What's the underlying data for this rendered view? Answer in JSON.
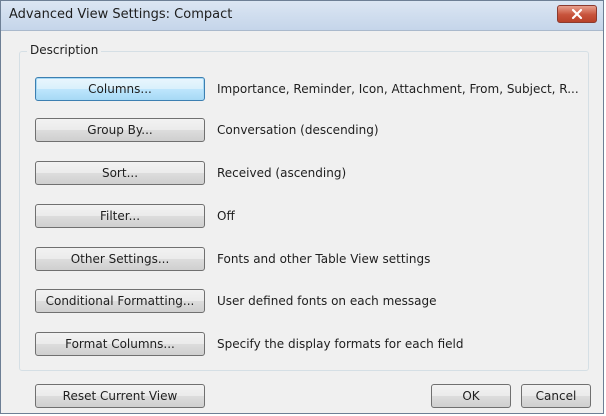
{
  "window": {
    "title": "Advanced View Settings: Compact"
  },
  "description_label": "Description",
  "settings": [
    {
      "button": "Columns...",
      "value": "Importance, Reminder, Icon, Attachment, From, Subject, R..."
    },
    {
      "button": "Group By...",
      "value": "Conversation (descending)"
    },
    {
      "button": "Sort...",
      "value": "Received (ascending)"
    },
    {
      "button": "Filter...",
      "value": "Off"
    },
    {
      "button": "Other Settings...",
      "value": "Fonts and other Table View settings"
    },
    {
      "button": "Conditional Formatting...",
      "value": "User defined fonts on each message"
    },
    {
      "button": "Format Columns...",
      "value": "Specify the display formats for each field"
    }
  ],
  "footer": {
    "reset": "Reset Current View",
    "ok": "OK",
    "cancel": "Cancel"
  },
  "icons": {
    "close": "close-icon"
  }
}
